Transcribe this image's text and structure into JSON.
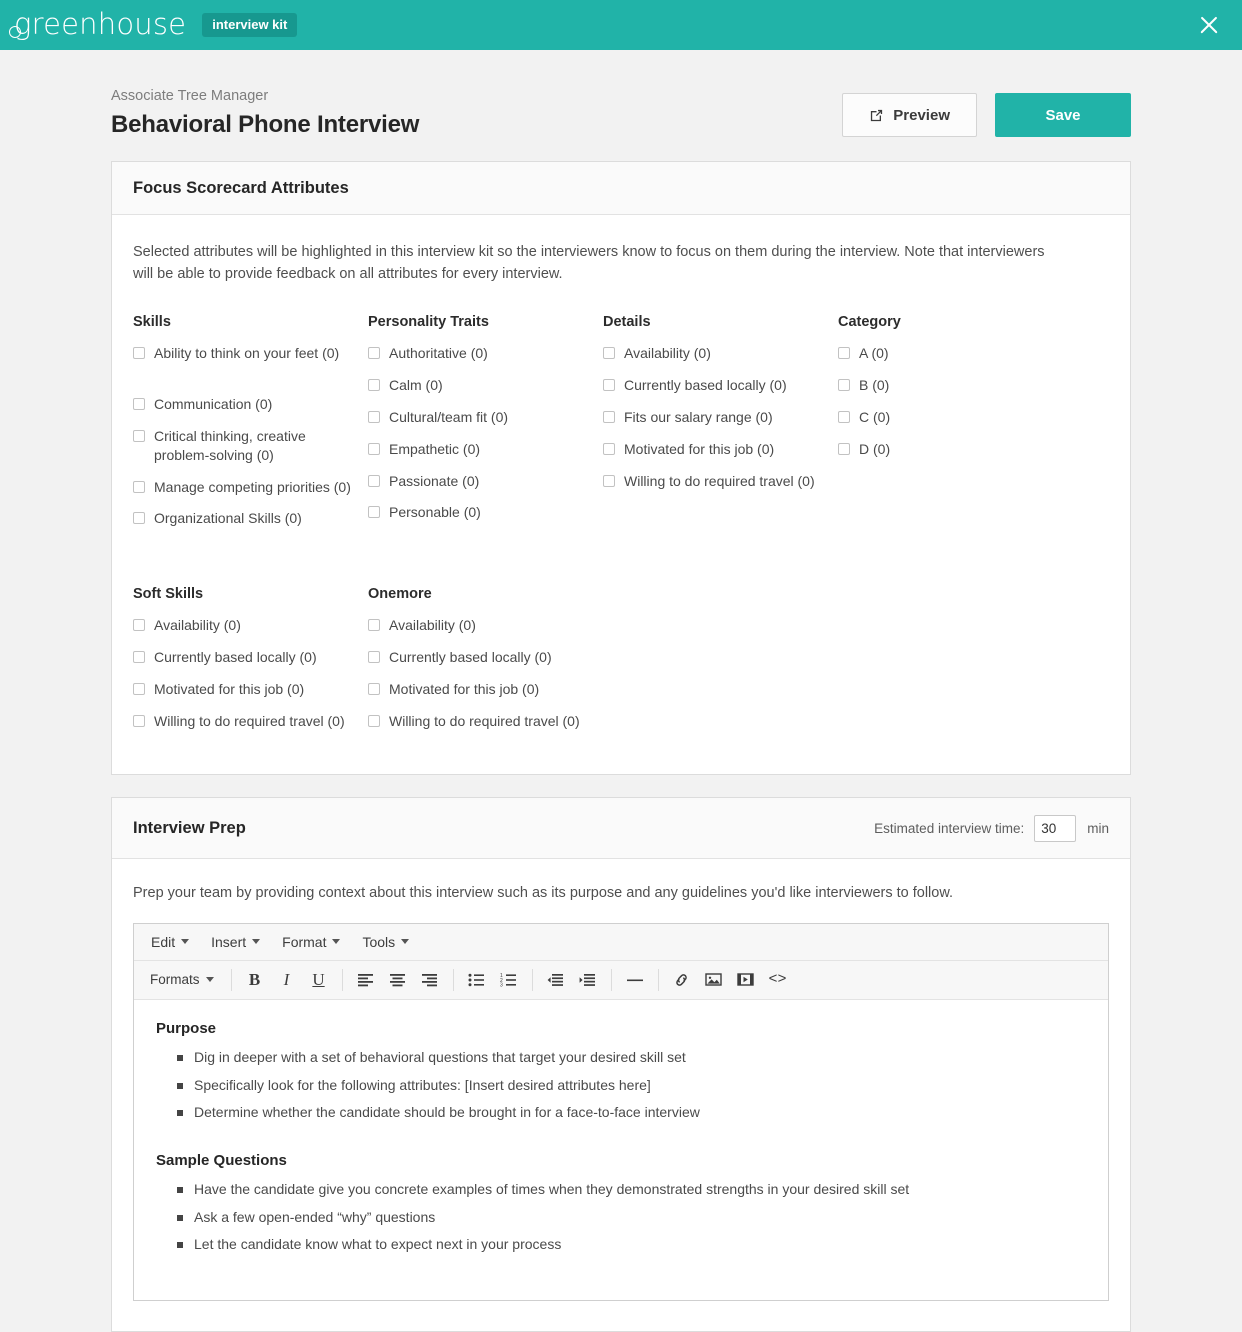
{
  "topbar": {
    "brand": "greenhouse",
    "badge": "interview kit",
    "close_icon": "close-icon",
    "accent_color": "#21b3a8",
    "badge_color": "#17988f"
  },
  "pagehead": {
    "eyebrow": "Associate Tree Manager",
    "title": "Behavioral Phone Interview",
    "preview_label": "Preview",
    "preview_icon": "external-link-icon",
    "save_label": "Save"
  },
  "focus_card": {
    "title": "Focus Scorecard Attributes",
    "intro": "Selected attributes will be highlighted in this interview kit so the interviewers know to focus on them during the interview. Note that interviewers will be able to provide feedback on all attributes for every interview.",
    "columns": [
      {
        "heading": "Skills",
        "items": [
          {
            "label": "Ability to think on your feet (0)",
            "checked": false,
            "tall": true
          },
          {
            "label": "Communication (0)",
            "checked": false
          },
          {
            "label": "Critical thinking, creative problem-solving (0)",
            "checked": false
          },
          {
            "label": "Manage competing priorities (0)",
            "checked": false
          },
          {
            "label": "Organizational Skills (0)",
            "checked": false
          }
        ]
      },
      {
        "heading": "Personality Traits",
        "items": [
          {
            "label": "Authoritative (0)",
            "checked": false
          },
          {
            "label": "Calm (0)",
            "checked": false
          },
          {
            "label": "Cultural/team fit (0)",
            "checked": false
          },
          {
            "label": "Empathetic (0)",
            "checked": false
          },
          {
            "label": "Passionate (0)",
            "checked": false
          },
          {
            "label": "Personable (0)",
            "checked": false
          }
        ]
      },
      {
        "heading": "Details",
        "items": [
          {
            "label": "Availability (0)",
            "checked": false
          },
          {
            "label": "Currently based locally (0)",
            "checked": false
          },
          {
            "label": "Fits our salary range (0)",
            "checked": false
          },
          {
            "label": "Motivated for this job (0)",
            "checked": false
          },
          {
            "label": "Willing to do required travel (0)",
            "checked": false
          }
        ]
      },
      {
        "heading": "Category",
        "items": [
          {
            "label": "A (0)",
            "checked": false
          },
          {
            "label": "B (0)",
            "checked": false
          },
          {
            "label": "C (0)",
            "checked": false
          },
          {
            "label": "D (0)",
            "checked": false
          }
        ]
      },
      {
        "heading": "Soft Skills",
        "items": [
          {
            "label": "Availability (0)",
            "checked": false
          },
          {
            "label": "Currently based locally (0)",
            "checked": false
          },
          {
            "label": "Motivated for this job (0)",
            "checked": false
          },
          {
            "label": "Willing to do required travel (0)",
            "checked": false
          }
        ]
      },
      {
        "heading": "Onemore",
        "items": [
          {
            "label": "Availability (0)",
            "checked": false
          },
          {
            "label": "Currently based locally (0)",
            "checked": false
          },
          {
            "label": "Motivated for this job (0)",
            "checked": false
          },
          {
            "label": "Willing to do required travel (0)",
            "checked": false
          }
        ]
      }
    ]
  },
  "prep_card": {
    "title": "Interview Prep",
    "estimated_label": "Estimated interview time:",
    "estimated_value": "30",
    "estimated_unit": "min",
    "help": "Prep your team by providing context about this interview such as its purpose and any guidelines you'd like interviewers to follow.",
    "editor": {
      "menus": [
        "Edit",
        "Insert",
        "Format",
        "Tools"
      ],
      "formats_label": "Formats",
      "tools": [
        {
          "name": "bold-icon",
          "glyph": "B"
        },
        {
          "name": "italic-icon",
          "glyph": "I"
        },
        {
          "name": "underline-icon",
          "glyph": "U"
        },
        {
          "name": "align-left-icon",
          "glyph": ""
        },
        {
          "name": "align-center-icon",
          "glyph": ""
        },
        {
          "name": "align-right-icon",
          "glyph": ""
        },
        {
          "name": "bullet-list-icon",
          "glyph": ""
        },
        {
          "name": "numbered-list-icon",
          "glyph": ""
        },
        {
          "name": "outdent-icon",
          "glyph": ""
        },
        {
          "name": "indent-icon",
          "glyph": ""
        },
        {
          "name": "horizontal-rule-icon",
          "glyph": ""
        },
        {
          "name": "link-icon",
          "glyph": ""
        },
        {
          "name": "image-icon",
          "glyph": ""
        },
        {
          "name": "media-icon",
          "glyph": ""
        },
        {
          "name": "source-code-icon",
          "glyph": "<>"
        }
      ],
      "content": {
        "purpose_heading": "Purpose",
        "purpose_items": [
          "Dig in deeper with a set of behavioral questions that target your desired skill set",
          "Specifically look for the following attributes: [Insert desired attributes here]",
          "Determine whether the candidate should be brought in for a face-to-face interview"
        ],
        "questions_heading": "Sample Questions",
        "questions_items": [
          "Have the candidate give you concrete examples of times when they demonstrated strengths in your desired skill set",
          "Ask a few open-ended “why” questions",
          "Let the candidate know what to expect next in your process"
        ]
      }
    }
  }
}
